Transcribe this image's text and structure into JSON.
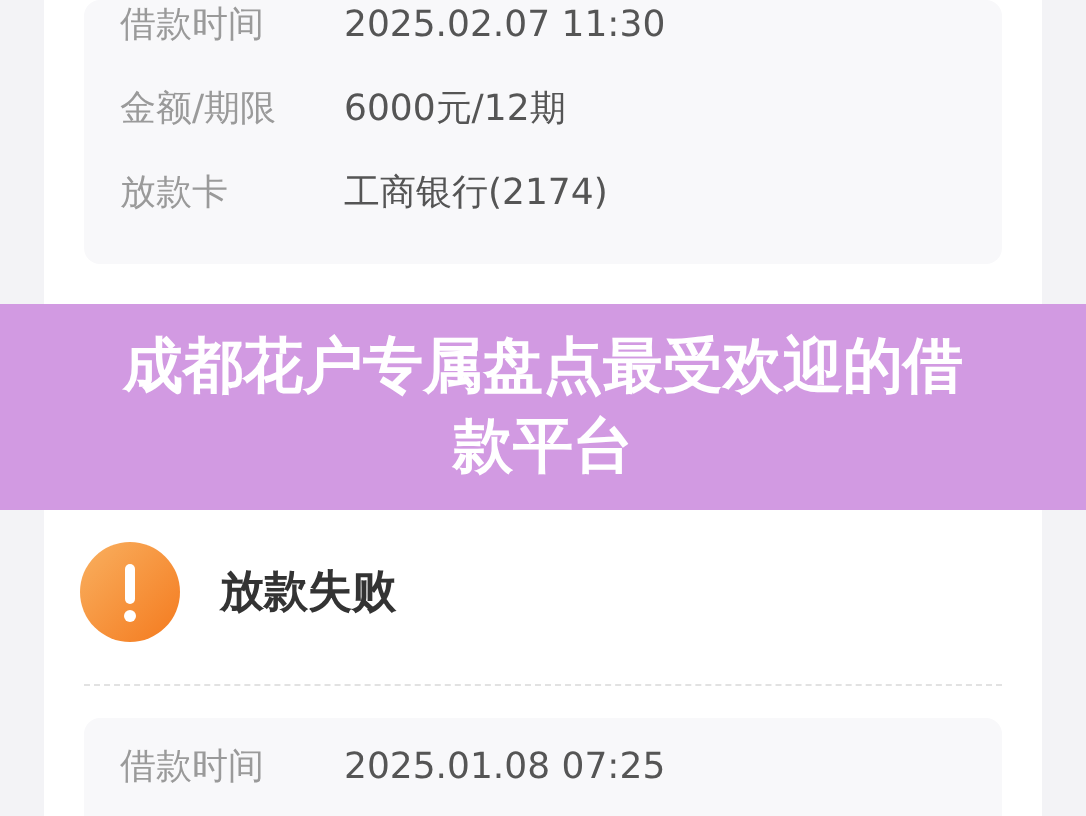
{
  "top_card": {
    "details": [
      {
        "label": "借款时间",
        "value": "2025.02.07 11:30"
      },
      {
        "label": "金额/期限",
        "value": "6000元/12期"
      },
      {
        "label": "放款卡",
        "value": "工商银行(2174)"
      }
    ]
  },
  "banner": {
    "title": "成都花户专属盘点最受欢迎的借款平台"
  },
  "bottom_card": {
    "status": "放款失败",
    "details": [
      {
        "label": "借款时间",
        "value": "2025.01.08 07:25"
      }
    ]
  }
}
